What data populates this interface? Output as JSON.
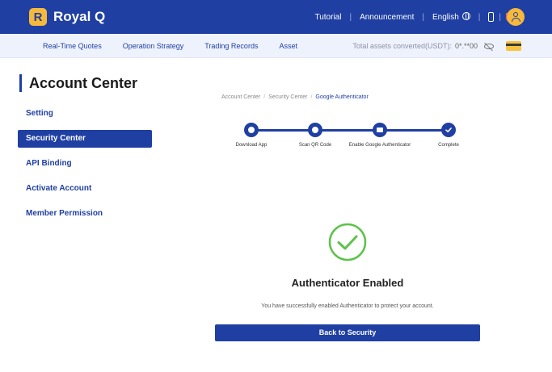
{
  "app": {
    "logo_letter": "R",
    "name": "Royal Q"
  },
  "topnav": {
    "tutorial": "Tutorial",
    "announcement": "Announcement",
    "language": "English"
  },
  "subnav": {
    "links": [
      "Real-Time Quotes",
      "Operation Strategy",
      "Trading Records",
      "Asset"
    ],
    "assets_label": "Total assets converted(USDT):",
    "assets_value": "0*.**00"
  },
  "sidebar": {
    "title": "Account Center",
    "items": [
      {
        "label": "Setting"
      },
      {
        "label": "Security Center"
      },
      {
        "label": "API Binding"
      },
      {
        "label": "Activate Account"
      },
      {
        "label": "Member Permission"
      }
    ]
  },
  "breadcrumb": [
    "Account Center",
    "Security Center",
    "Google Authenticator"
  ],
  "steps": [
    {
      "label": "Download App",
      "icon": "download-icon"
    },
    {
      "label": "Scan QR Code",
      "icon": "scan-icon"
    },
    {
      "label": "Enable Google Authenticator",
      "icon": "keypad-icon"
    },
    {
      "label": "Complete",
      "icon": "check-icon"
    }
  ],
  "result": {
    "title": "Authenticator Enabled",
    "description": "You have successfully enabled Authenticator to protect your account.",
    "button": "Back to Security"
  },
  "colors": {
    "primary": "#1f3fa3",
    "accent": "#f6b93b",
    "success": "#5ec24a"
  }
}
